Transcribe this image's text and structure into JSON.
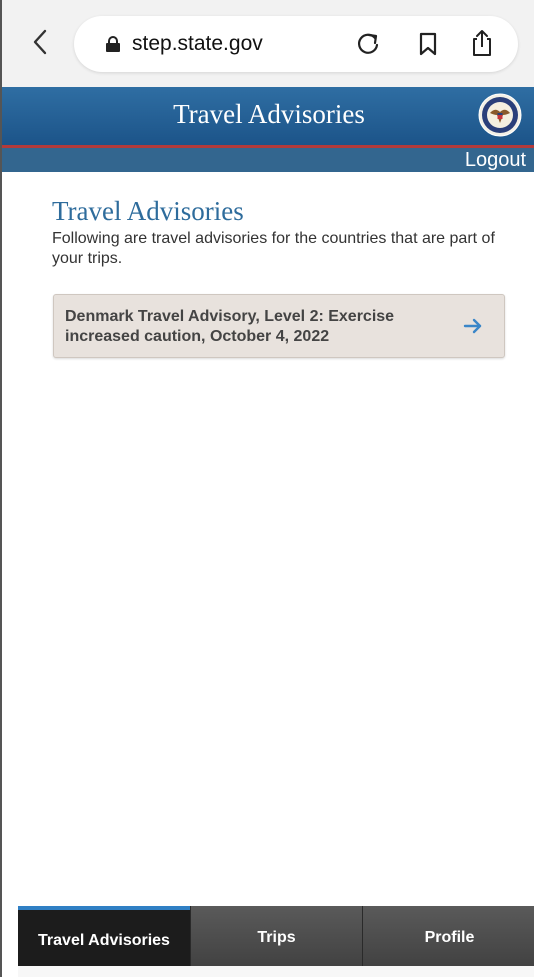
{
  "browser": {
    "url": "step.state.gov",
    "back_icon": "chevron-left-icon",
    "lock_icon": "lock-icon",
    "reload_icon": "reload-icon",
    "bookmark_icon": "bookmark-icon",
    "share_icon": "share-icon"
  },
  "header": {
    "title": "Travel Advisories",
    "seal_icon": "state-department-seal-icon",
    "logout_label": "Logout",
    "colors": {
      "header_blue": "#1c5489",
      "accent_red": "#b33a3a",
      "subheader": "#33668f"
    }
  },
  "content": {
    "title": "Travel Advisories",
    "description": "Following are travel advisories for the countries that are part of your trips.",
    "advisories": [
      {
        "label": "Denmark Travel Advisory, Level 2: Exercise increased caution, October 4, 2022"
      }
    ],
    "arrow_icon": "arrow-right-icon",
    "colors": {
      "title_blue": "#2e6c9c",
      "card_bg": "#e8e2dd",
      "arrow_blue": "#3a86c8"
    }
  },
  "tabs": [
    {
      "label": "Travel Advisories",
      "active": true
    },
    {
      "label": "Trips",
      "active": false
    },
    {
      "label": "Profile",
      "active": false
    }
  ]
}
